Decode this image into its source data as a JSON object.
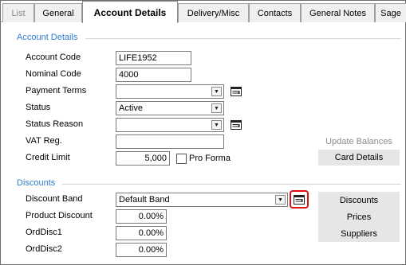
{
  "tabs": [
    {
      "label": "List"
    },
    {
      "label": "General"
    },
    {
      "label": "Account Details"
    },
    {
      "label": "Delivery/Misc"
    },
    {
      "label": "Contacts"
    },
    {
      "label": "General Notes"
    },
    {
      "label": "Sage"
    }
  ],
  "account_details": {
    "section_title": "Account Details",
    "account_code": {
      "label": "Account Code",
      "value": "LIFE1952"
    },
    "nominal_code": {
      "label": "Nominal Code",
      "value": "4000"
    },
    "payment_terms": {
      "label": "Payment Terms",
      "value": ""
    },
    "status": {
      "label": "Status",
      "value": "Active"
    },
    "status_reason": {
      "label": "Status Reason",
      "value": ""
    },
    "vat_reg": {
      "label": "VAT Reg.",
      "value": ""
    },
    "credit_limit": {
      "label": "Credit Limit",
      "value": "5,000"
    },
    "pro_forma": {
      "label": "Pro Forma",
      "checked": false
    },
    "update_balances_label": "Update Balances",
    "card_details_label": "Card Details"
  },
  "discounts": {
    "section_title": "Discounts",
    "discount_band": {
      "label": "Discount Band",
      "value": "Default Band"
    },
    "product_discount": {
      "label": "Product Discount",
      "value": "0.00%"
    },
    "orddisc1": {
      "label": "OrdDisc1",
      "value": "0.00%"
    },
    "orddisc2": {
      "label": "OrdDisc2",
      "value": "0.00%"
    },
    "buttons": {
      "discounts": "Discounts",
      "prices": "Prices",
      "suppliers": "Suppliers"
    }
  },
  "colors": {
    "section_title": "#2f7ccf",
    "highlight": "#e01010",
    "button_bg": "#e6e6e6",
    "disabled_text": "#8a8a8a"
  },
  "icons": {
    "lookup": "lookup-list-icon",
    "dropdown": "chevron-down-icon"
  }
}
